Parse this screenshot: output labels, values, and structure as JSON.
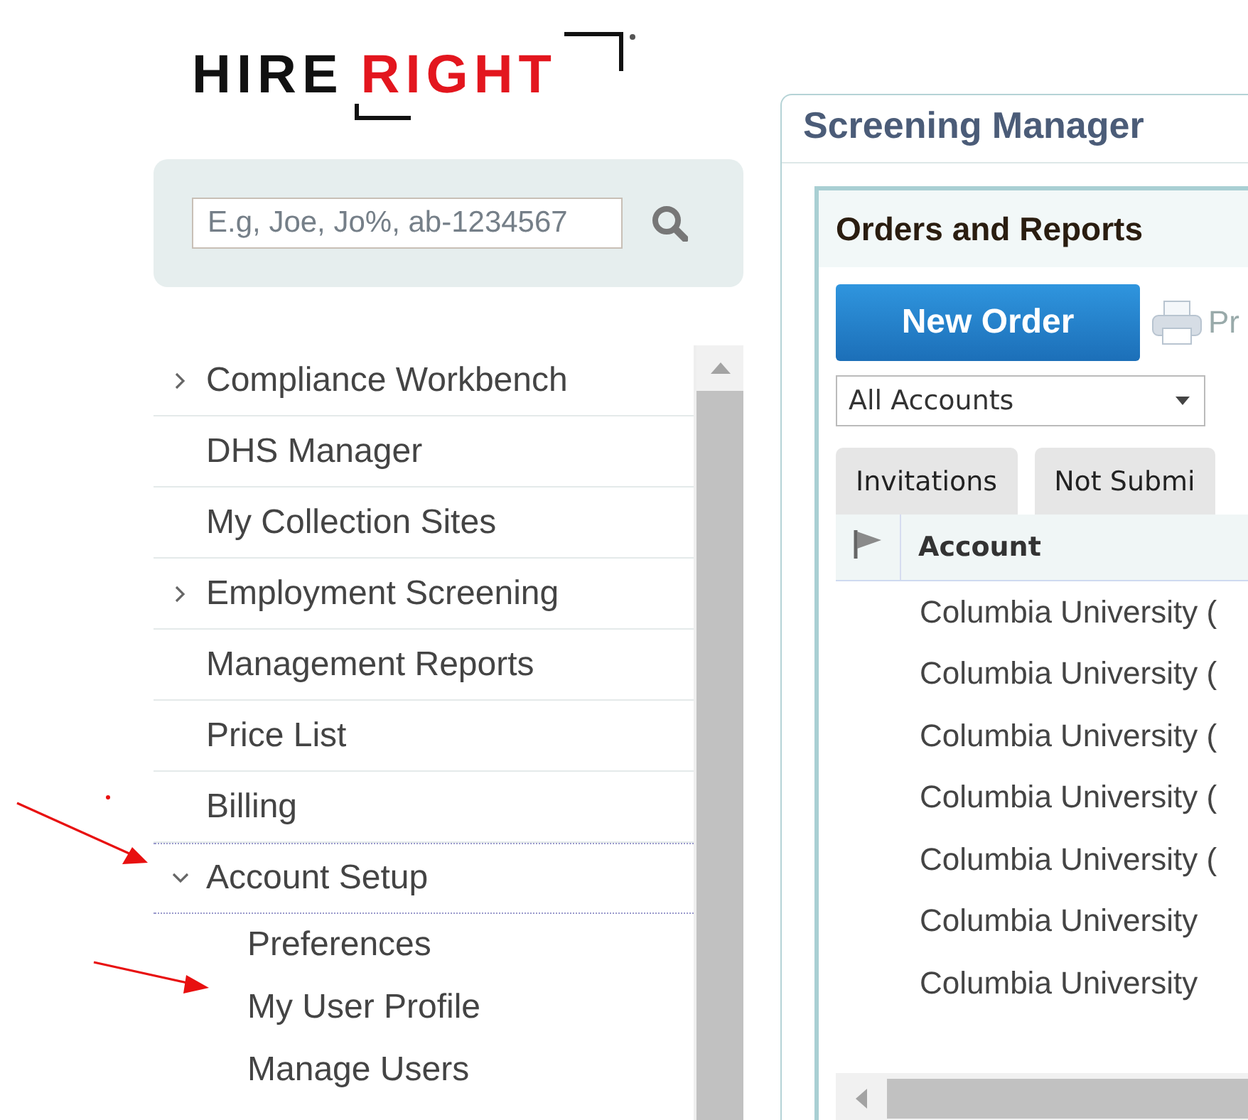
{
  "logo": {
    "word_1": "HIRE",
    "word_2": "RIGHT"
  },
  "search": {
    "placeholder": "E.g, Joe, Jo%, ab-1234567"
  },
  "menu": [
    {
      "label": "Compliance Workbench",
      "expanded": false
    },
    {
      "label": "DHS Manager"
    },
    {
      "label": "My Collection Sites"
    },
    {
      "label": "Employment Screening",
      "expanded": false
    },
    {
      "label": "Management Reports"
    },
    {
      "label": "Price List"
    },
    {
      "label": "Billing"
    },
    {
      "label": "Account Setup",
      "expanded": true,
      "children": [
        {
          "label": "Preferences"
        },
        {
          "label": "My User Profile"
        },
        {
          "label": "Manage Users"
        }
      ]
    }
  ],
  "panel": {
    "title": "Screening Manager",
    "section": {
      "title": "Orders and Reports",
      "new_order_button": "New Order",
      "print_label": "Pr",
      "account_select": "All Accounts",
      "tabs": [
        {
          "label": "Invitations",
          "selected": false
        },
        {
          "label": "Not Submi",
          "selected": false
        }
      ],
      "table": {
        "columns": [
          "Account"
        ],
        "rows": [
          "Columbia University (",
          "Columbia University (",
          "Columbia University (",
          "Columbia University (",
          "Columbia University (",
          "Columbia University",
          "Columbia University"
        ]
      }
    }
  }
}
